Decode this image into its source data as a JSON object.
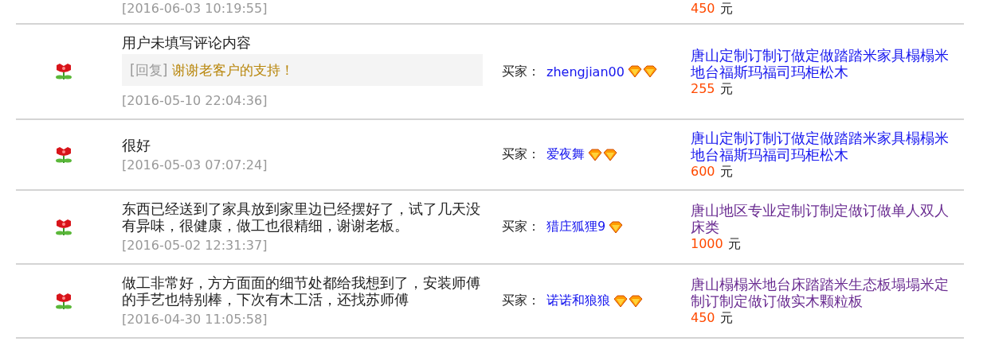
{
  "reviews": [
    {
      "kind": "partial",
      "timestamp": "[2016-06-03 10:19:55]",
      "price": "450",
      "currency": "元"
    },
    {
      "kind": "full",
      "comment": "用户未填写评论内容",
      "reply_label": "[回复]",
      "reply": "谢谢老客户的支持！",
      "timestamp": "[2016-05-10 22:04:36]",
      "buyer_label": "买家：",
      "buyer": "zhengjian00",
      "rank_icons": [
        {
          "kind": "diamond"
        },
        {
          "kind": "diamond"
        }
      ],
      "product": "唐山定制订制订做定做踏踏米家具榻榻米地台福斯玛福司玛柜松木",
      "visited": false,
      "price": "255",
      "currency": "元"
    },
    {
      "kind": "full",
      "comment": "很好",
      "timestamp": "[2016-05-03 07:07:24]",
      "buyer_label": "买家：",
      "buyer": "爱夜舞",
      "rank_icons": [
        {
          "kind": "diamond"
        },
        {
          "kind": "diamond"
        }
      ],
      "product": "唐山定制订制订做定做踏踏米家具榻榻米地台福斯玛福司玛柜松木",
      "visited": false,
      "price": "600",
      "currency": "元"
    },
    {
      "kind": "full",
      "comment": "东西已经送到了家具放到家里边已经摆好了，试了几天没有异味，很健康，做工也很精细，谢谢老板。",
      "timestamp": "[2016-05-02 12:31:37]",
      "buyer_label": "买家：",
      "buyer": "猎庄狐狸9",
      "rank_icons": [
        {
          "kind": "diamond"
        }
      ],
      "product": "唐山地区专业定制订制定做订做单人双人床类",
      "visited": true,
      "price": "1000",
      "currency": "元"
    },
    {
      "kind": "full",
      "comment": "做工非常好，方方面面的细节处都给我想到了，安装师傅的手艺也特别棒，下次有木工活，还找苏师傅",
      "timestamp": "[2016-04-30 11:05:58]",
      "buyer_label": "买家：",
      "buyer": "诺诺和狼狼",
      "rank_icons": [
        {
          "kind": "diamond"
        },
        {
          "kind": "diamond"
        }
      ],
      "product": "唐山榻榻米地台床踏踏米生态板塌塌米定制订制定做订做实木颗粒板",
      "visited": true,
      "price": "450",
      "currency": "元"
    }
  ]
}
